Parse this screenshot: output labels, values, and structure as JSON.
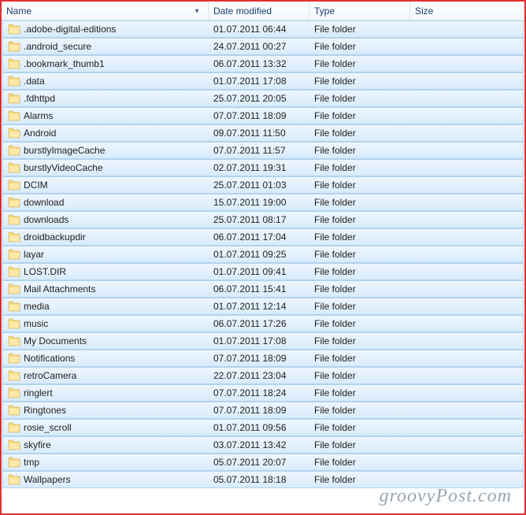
{
  "columns": {
    "name": "Name",
    "date": "Date modified",
    "type": "Type",
    "size": "Size"
  },
  "files": [
    {
      "name": ".adobe-digital-editions",
      "date": "01.07.2011 06:44",
      "type": "File folder",
      "size": ""
    },
    {
      "name": ".android_secure",
      "date": "24.07.2011 00:27",
      "type": "File folder",
      "size": ""
    },
    {
      "name": ".bookmark_thumb1",
      "date": "06.07.2011 13:32",
      "type": "File folder",
      "size": ""
    },
    {
      "name": ".data",
      "date": "01.07.2011 17:08",
      "type": "File folder",
      "size": ""
    },
    {
      "name": ".fdhttpd",
      "date": "25.07.2011 20:05",
      "type": "File folder",
      "size": ""
    },
    {
      "name": "Alarms",
      "date": "07.07.2011 18:09",
      "type": "File folder",
      "size": ""
    },
    {
      "name": "Android",
      "date": "09.07.2011 11:50",
      "type": "File folder",
      "size": ""
    },
    {
      "name": "burstlyImageCache",
      "date": "07.07.2011 11:57",
      "type": "File folder",
      "size": ""
    },
    {
      "name": "burstlyVideoCache",
      "date": "02.07.2011 19:31",
      "type": "File folder",
      "size": ""
    },
    {
      "name": "DCIM",
      "date": "25.07.2011 01:03",
      "type": "File folder",
      "size": ""
    },
    {
      "name": "download",
      "date": "15.07.2011 19:00",
      "type": "File folder",
      "size": ""
    },
    {
      "name": "downloads",
      "date": "25.07.2011 08:17",
      "type": "File folder",
      "size": ""
    },
    {
      "name": "droidbackupdir",
      "date": "06.07.2011 17:04",
      "type": "File folder",
      "size": ""
    },
    {
      "name": "layar",
      "date": "01.07.2011 09:25",
      "type": "File folder",
      "size": ""
    },
    {
      "name": "LOST.DIR",
      "date": "01.07.2011 09:41",
      "type": "File folder",
      "size": ""
    },
    {
      "name": "Mail Attachments",
      "date": "06.07.2011 15:41",
      "type": "File folder",
      "size": ""
    },
    {
      "name": "media",
      "date": "01.07.2011 12:14",
      "type": "File folder",
      "size": ""
    },
    {
      "name": "music",
      "date": "06.07.2011 17:26",
      "type": "File folder",
      "size": ""
    },
    {
      "name": "My Documents",
      "date": "01.07.2011 17:08",
      "type": "File folder",
      "size": ""
    },
    {
      "name": "Notifications",
      "date": "07.07.2011 18:09",
      "type": "File folder",
      "size": ""
    },
    {
      "name": "retroCamera",
      "date": "22.07.2011 23:04",
      "type": "File folder",
      "size": ""
    },
    {
      "name": "ringlert",
      "date": "07.07.2011 18:24",
      "type": "File folder",
      "size": ""
    },
    {
      "name": "Ringtones",
      "date": "07.07.2011 18:09",
      "type": "File folder",
      "size": ""
    },
    {
      "name": "rosie_scroll",
      "date": "01.07.2011 09:56",
      "type": "File folder",
      "size": ""
    },
    {
      "name": "skyfire",
      "date": "03.07.2011 13:42",
      "type": "File folder",
      "size": ""
    },
    {
      "name": "tmp",
      "date": "05.07.2011 20:07",
      "type": "File folder",
      "size": ""
    },
    {
      "name": "Wallpapers",
      "date": "05.07.2011 18:18",
      "type": "File folder",
      "size": ""
    }
  ],
  "watermark": "groovyPost.com"
}
